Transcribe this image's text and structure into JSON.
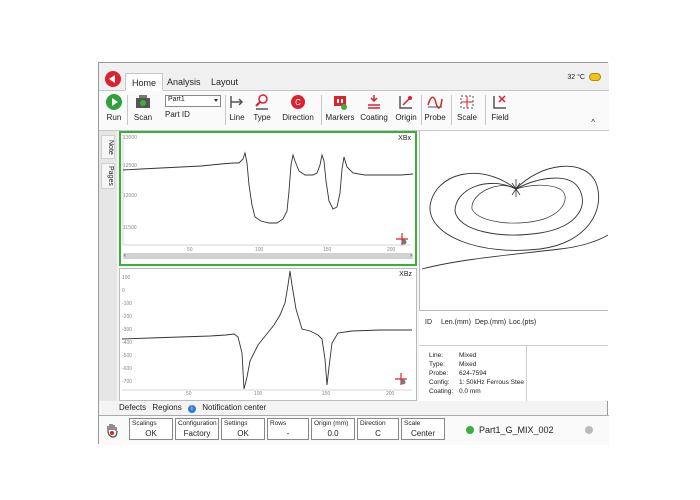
{
  "menu": {
    "tabs": [
      "Home",
      "Analysis",
      "Layout"
    ],
    "active": "Home",
    "temperature": "32 °C"
  },
  "ribbon": {
    "run": "Run",
    "scan": "Scan",
    "part_select": "Part1",
    "part_id": "Part ID",
    "line": "Line",
    "type": "Type",
    "direction": "Direction",
    "markers": "Markers",
    "coating": "Coating",
    "origin": "Origin",
    "probe": "Probe",
    "scale": "Scale",
    "field": "Field",
    "collapse": "^"
  },
  "side_tabs": [
    "Note",
    "Pages"
  ],
  "charts": {
    "x": {
      "label": "XBx",
      "y_ticks": [
        "13000",
        "12500",
        "12000",
        "11500"
      ],
      "x_ticks": [
        "50",
        "100",
        "150",
        "200"
      ]
    },
    "z": {
      "label": "XBz",
      "y_ticks": [
        "100",
        "0",
        "-100",
        "-200",
        "-300",
        "-400",
        "-500",
        "-600",
        "-700"
      ],
      "x_ticks": [
        "50",
        "100",
        "150",
        "200"
      ]
    }
  },
  "defect_table": {
    "columns": [
      "ID",
      "Len.(mm)",
      "Dep.(mm)",
      "Loc.(pts)"
    ]
  },
  "info": [
    {
      "k": "Line:",
      "v": "Mixed"
    },
    {
      "k": "Type:",
      "v": "Mixed"
    },
    {
      "k": "Probe:",
      "v": "624-7594"
    },
    {
      "k": "Config:",
      "v": "1: 50kHz Ferrous Stee"
    },
    {
      "k": "Coating:",
      "v": "0.0 mm"
    }
  ],
  "bottom_tabs": {
    "defects": "Defects",
    "regions": "Regions",
    "notification": "Notification center",
    "notif_icon": "i"
  },
  "status": {
    "cells": [
      {
        "title": "Scalings",
        "value": "OK"
      },
      {
        "title": "Configuration",
        "value": "Factory"
      },
      {
        "title": "Settings",
        "value": "OK"
      },
      {
        "title": "Rows",
        "value": "-"
      },
      {
        "title": "Origin (mm)",
        "value": "0.0"
      },
      {
        "title": "Direction",
        "value": "C"
      },
      {
        "title": "Scale",
        "value": "Center"
      }
    ],
    "file": "Part1_G_MIX_002"
  },
  "colors": {
    "accent_green": "#3cae3c",
    "run_green": "#2fa33a",
    "red": "#d9232e"
  }
}
